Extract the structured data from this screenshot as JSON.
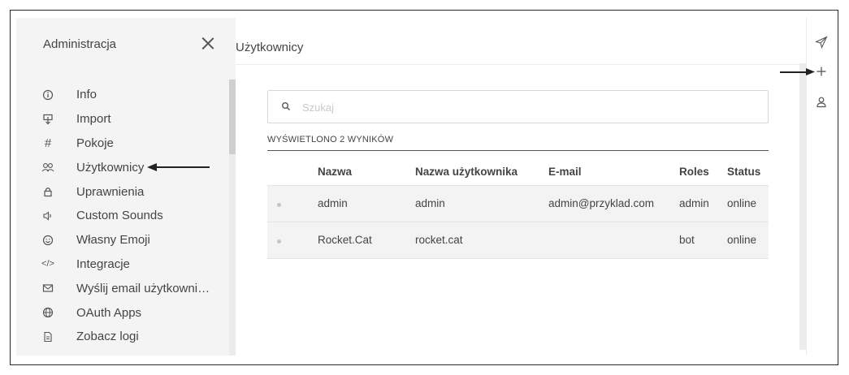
{
  "sidebar": {
    "title": "Administracja",
    "items": [
      {
        "icon": "info-icon",
        "label": "Info"
      },
      {
        "icon": "import-icon",
        "label": "Import"
      },
      {
        "icon": "hashtag-icon",
        "label": "Pokoje"
      },
      {
        "icon": "users-icon",
        "label": "Użytkownicy"
      },
      {
        "icon": "lock-icon",
        "label": "Uprawnienia"
      },
      {
        "icon": "volume-icon",
        "label": "Custom Sounds"
      },
      {
        "icon": "emoji-icon",
        "label": "Własny Emoji"
      },
      {
        "icon": "code-icon",
        "label": "Integracje"
      },
      {
        "icon": "mail-icon",
        "label": "Wyślij email użytkowni…"
      },
      {
        "icon": "globe-icon",
        "label": "OAuth Apps"
      },
      {
        "icon": "file-icon",
        "label": "Zobacz logi"
      }
    ]
  },
  "main": {
    "title": "Użytkownicy",
    "search": {
      "placeholder": "Szukaj",
      "value": ""
    },
    "results_label": "WYŚWIETLONO 2 WYNIKÓW",
    "table": {
      "headers": [
        "",
        "Nazwa",
        "Nazwa użytkownika",
        "E-mail",
        "Roles",
        "Status"
      ],
      "rows": [
        {
          "name": "admin",
          "username": "admin",
          "email": "admin@przyklad.com",
          "roles": "admin",
          "status": "online"
        },
        {
          "name": "Rocket.Cat",
          "username": "rocket.cat",
          "email": "",
          "roles": "bot",
          "status": "online"
        }
      ]
    }
  },
  "right_panel": {
    "icons": [
      "send-icon",
      "add-icon",
      "user-icon"
    ]
  }
}
